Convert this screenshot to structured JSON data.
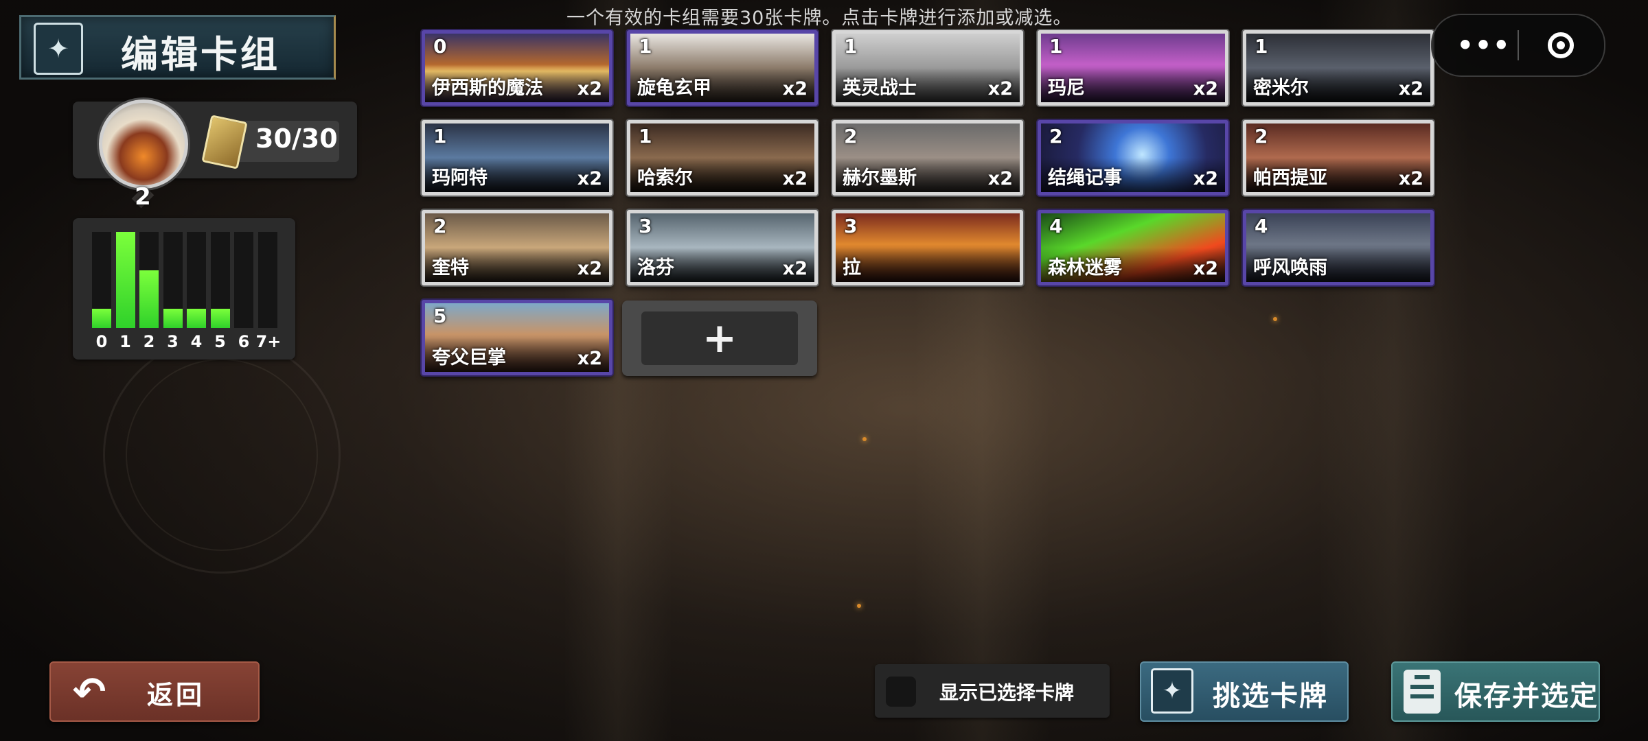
{
  "header": {
    "hint": "一个有效的卡组需要30张卡牌。点击卡牌进行添加或减选。",
    "title": "编辑卡组"
  },
  "hero": {
    "cost": "2",
    "card_count": "30/30"
  },
  "mana_curve": {
    "labels": [
      "0",
      "1",
      "2",
      "3",
      "4",
      "5",
      "6",
      "7+"
    ],
    "counts": [
      2,
      10,
      6,
      2,
      2,
      2,
      0,
      0
    ],
    "max": 10,
    "bar_color": "#5ce83a"
  },
  "cards": [
    {
      "cost": "0",
      "name": "伊西斯的魔法",
      "qty": "x2",
      "frame": "purple",
      "art": "linear-gradient(180deg,#3a3466 0%,#b4682e 45%,#f3c76a 55%,#3a2a4a 100%)"
    },
    {
      "cost": "1",
      "name": "旋龟玄甲",
      "qty": "x2",
      "frame": "purple",
      "art": "linear-gradient(180deg,#e9e6e2 0%,#8c7b6a 50%,#3b3028 100%)"
    },
    {
      "cost": "1",
      "name": "英灵战士",
      "qty": "x2",
      "frame": "silver",
      "art": "linear-gradient(180deg,#cfcfcf 0%,#9a9a9a 50%,#4a4a4a 100%)"
    },
    {
      "cost": "1",
      "name": "玛尼",
      "qty": "x2",
      "frame": "silver",
      "art": "linear-gradient(180deg,#6e3c8e 0%,#c25fc7 45%,#3a2050 100%)"
    },
    {
      "cost": "1",
      "name": "密米尔",
      "qty": "x2",
      "frame": "silver",
      "art": "linear-gradient(180deg,#2c2f36 0%,#5a606c 50%,#15171b 100%)"
    },
    {
      "cost": "1",
      "name": "玛阿特",
      "qty": "x2",
      "frame": "silver",
      "art": "linear-gradient(180deg,#2b3346 0%,#5b7aa0 50%,#1a1f2a 100%)"
    },
    {
      "cost": "1",
      "name": "哈索尔",
      "qty": "x2",
      "frame": "silver",
      "art": "linear-gradient(180deg,#3b2a22 0%,#8a6a4e 50%,#21170f 100%)"
    },
    {
      "cost": "2",
      "name": "赫尔墨斯",
      "qty": "x2",
      "frame": "silver",
      "art": "linear-gradient(180deg,#6a6a6a 0%,#9b8f86 50%,#3a3430 100%)"
    },
    {
      "cost": "2",
      "name": "结绳记事",
      "qty": "x2",
      "frame": "purple",
      "art": "radial-gradient(circle at 55% 45%,#bfe6ff 0%,#3e76d6 25%,#262a62 60%,#1a1a3a 100%)"
    },
    {
      "cost": "2",
      "name": "帕西提亚",
      "qty": "x2",
      "frame": "silver",
      "art": "linear-gradient(180deg,#5a2b22 0%,#b06a4e 50%,#2c1712 100%)"
    },
    {
      "cost": "2",
      "name": "奎特",
      "qty": "x2",
      "frame": "silver",
      "art": "linear-gradient(180deg,#6b5a48 0%,#c9a77a 50%,#3a2d22 100%)"
    },
    {
      "cost": "3",
      "name": "洛芬",
      "qty": "x2",
      "frame": "silver",
      "art": "linear-gradient(180deg,#56646e 0%,#a8b6bf 50%,#2c343a 100%)"
    },
    {
      "cost": "3",
      "name": "拉",
      "qty": "",
      "frame": "silver",
      "art": "linear-gradient(180deg,#7a2a1e 0%,#e0882e 45%,#3a1612 100%)"
    },
    {
      "cost": "4",
      "name": "森林迷雾",
      "qty": "x2",
      "frame": "purple",
      "art": "linear-gradient(160deg,#1a4a18 0%,#59d82a 35%,#f04a1e 70%,#2a1810 100%)"
    },
    {
      "cost": "4",
      "name": "呼风唤雨",
      "qty": "",
      "frame": "purple",
      "art": "linear-gradient(180deg,#3a4256 0%,#6d7686 45%,#1e2230 100%)"
    },
    {
      "cost": "5",
      "name": "夸父巨掌",
      "qty": "x2",
      "frame": "purple",
      "art": "linear-gradient(180deg,#7ea8c8 0%,#c79468 45%,#4a2c22 100%)"
    }
  ],
  "add_slot": {
    "icon": "+"
  },
  "capsule": {
    "more": "•••"
  },
  "buttons": {
    "back": "返回",
    "show_selected": "显示已选择卡牌",
    "pick_cards": "挑选卡牌",
    "save": "保存并选定"
  }
}
